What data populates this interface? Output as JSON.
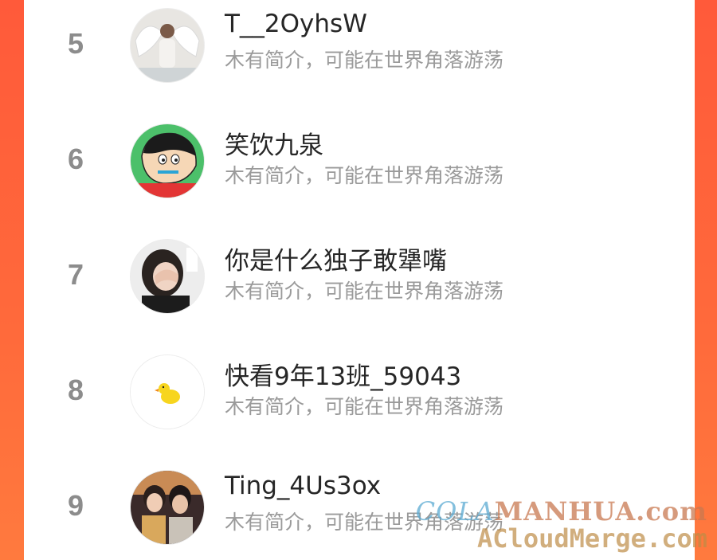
{
  "ranking": [
    {
      "rank": "5",
      "name": "T__2OyhsW",
      "bio": "木有简介，可能在世界角落游荡",
      "avatar": "angel-wings-photo-avatar"
    },
    {
      "rank": "6",
      "name": "笑饮九泉",
      "bio": "木有简介，可能在世界角落游荡",
      "avatar": "cartoon-boy-avatar"
    },
    {
      "rank": "7",
      "name": "你是什么独子敢犟嘴",
      "bio": "木有简介，可能在世界角落游荡",
      "avatar": "girl-covering-face-avatar"
    },
    {
      "rank": "8",
      "name": "快看9年13班_59043",
      "bio": "木有简介，可能在世界角落游荡",
      "avatar": "yellow-duck-avatar"
    },
    {
      "rank": "9",
      "name": "Ting_4Us3ox",
      "bio": "木有简介，可能在世界角落游荡",
      "avatar": "two-people-photo-avatar"
    }
  ],
  "watermark": {
    "line1_prefix": "COLA",
    "line1_suffix": "MANHUA.com",
    "line2": "ACloudMerge.com"
  },
  "colors": {
    "background": "#ff5a3a",
    "rank": "#8c8c8c",
    "name": "#262626",
    "bio": "#9a9a9a"
  }
}
